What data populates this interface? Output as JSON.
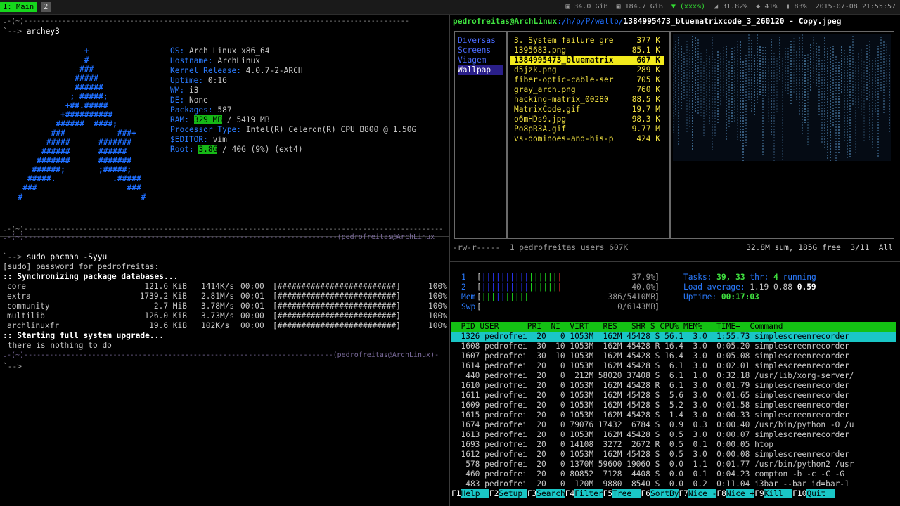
{
  "topbar": {
    "workspaces": [
      {
        "label": "1: Main"
      },
      {
        "label": "2"
      }
    ],
    "status": {
      "disk1": "34.0 GiB",
      "disk2": "184.7 GiB",
      "wifi": "(xxx%)",
      "wifi_signal": "31.82%",
      "temp": "41%",
      "battery": "83%",
      "datetime": "2015-07-08 21:55:57"
    }
  },
  "left_top": {
    "prompt1": ".-(~)-------------------------------------------------------------------------------------------",
    "prompt2": "`--> ",
    "command": "archey3",
    "logo_lines": [
      "                +",
      "                #",
      "               ###",
      "              #####",
      "              ######",
      "             ; #####;",
      "            +##.#####",
      "           +##########",
      "          ######  ####;",
      "         ###           ###+",
      "        #####      #######",
      "       ######      ######",
      "      #######      #######",
      "     ######;       ;#####;",
      "    #####.            .#####",
      "   ###                   ###",
      "  #                         #"
    ],
    "info": [
      {
        "key": "OS:",
        "value": " Arch Linux x86_64"
      },
      {
        "key": "Hostname:",
        "value": " ArchLinux"
      },
      {
        "key": "Kernel Release:",
        "value": " 4.0.7-2-ARCH"
      },
      {
        "key": "Uptime:",
        "value": " 0:16"
      },
      {
        "key": "WM:",
        "value": " i3"
      },
      {
        "key": "DE:",
        "value": " None"
      },
      {
        "key": "Packages:",
        "value": " 587"
      },
      {
        "key": "RAM:",
        "value_hl": "329 MB",
        "value": " / 5419 MB"
      },
      {
        "key": "Processor Type:",
        "value": " Intel(R) Celeron(R) CPU B800 @ 1.50G"
      },
      {
        "key": "$EDITOR:",
        "value": " vim"
      },
      {
        "key": "Root:",
        "value_hl": "3.8G",
        "value": " / 40G (9%) (ext4)"
      }
    ],
    "bottom_prompt": ".-(~)---------------------------------------------------------------------------------------------------"
  },
  "left_bottom": {
    "prompt_top": ".-(~)--------------------------------------------------------------------------(pedrofreitas@ArchLinux",
    "prompt_cmd_arrow": "`--> ",
    "command": "sudo pacman -Syyu",
    "sudo_line": "[sudo] password for pedrofreitas:",
    "sync_line": ":: Synchronizing package databases...",
    "repos": [
      {
        "name": "core",
        "size": "121.6 KiB",
        "speed": "1414K/s",
        "time": "00:00",
        "bar": "[#########################]",
        "pct": "100%"
      },
      {
        "name": "extra",
        "size": "1739.2 KiB",
        "speed": "2.81M/s",
        "time": "00:01",
        "bar": "[#########################]",
        "pct": "100%"
      },
      {
        "name": "community",
        "size": "2.7 MiB",
        "speed": "3.78M/s",
        "time": "00:01",
        "bar": "[#########################]",
        "pct": "100%"
      },
      {
        "name": "multilib",
        "size": "126.0 KiB",
        "speed": "3.73M/s",
        "time": "00:00",
        "bar": "[#########################]",
        "pct": "100%"
      },
      {
        "name": "archlinuxfr",
        "size": "19.6 KiB",
        "speed": "102K/s",
        "time": "00:00",
        "bar": "[#########################]",
        "pct": "100%"
      }
    ],
    "upgrade_line": ":: Starting full system upgrade...",
    "nothing_line": " there is nothing to do",
    "prompt_end": ".-(~)-------------------------------------------------------------------------(pedrofreitas@ArchLinux)-",
    "prompt_last": "`--> "
  },
  "ranger": {
    "path_user": "pedrofreitas@ArchLinux",
    "path_dir": ":/h/p/P/wallp/",
    "path_file": "1384995473_bluematrixcode_3_260120 - Copy.jpeg",
    "dirs": [
      {
        "label": "Diversas"
      },
      {
        "label": "Screens"
      },
      {
        "label": "Viagem"
      },
      {
        "label": "Wallpap"
      }
    ],
    "files": [
      {
        "name": "3. System failure gre",
        "size": "377 K"
      },
      {
        "name": "1395683.png",
        "size": "85.1 K"
      },
      {
        "name": "1384995473_bluematrix",
        "size": "607 K"
      },
      {
        "name": "d5jzk.png",
        "size": "289 K"
      },
      {
        "name": "fiber-optic-cable-ser",
        "size": "705 K"
      },
      {
        "name": "gray_arch.png",
        "size": "760 K"
      },
      {
        "name": "hacking-matrix_00280",
        "size": "88.5 K"
      },
      {
        "name": "MatrixCode.gif",
        "size": "19.7 M"
      },
      {
        "name": "o6mHDs9.jpg",
        "size": "98.3 K"
      },
      {
        "name": "Po8pR3A.gif",
        "size": "9.77 M"
      },
      {
        "name": "vs-dominoes-and-his-p",
        "size": "424 K"
      }
    ],
    "status_left": "-rw-r-----  1 pedrofreitas users 607K",
    "status_right": "32.8M sum, 185G free  3/11  All"
  },
  "htop": {
    "cpus": [
      {
        "n": "1",
        "pct": "37.9%"
      },
      {
        "n": "2",
        "pct": "40.0%"
      }
    ],
    "mem_label": "Mem",
    "mem_val": "386/5410MB",
    "swp_label": "Swp",
    "swp_val": "0/6143MB",
    "tasks_label": "Tasks:",
    "tasks_val": "39,",
    "thr_val": "33",
    "thr_label": " thr;",
    "running_val": "4",
    "running_label": " running",
    "load_label": "Load average:",
    "load1": "1.19",
    "load5": "0.88",
    "load15": "0.59",
    "uptime_label": "Uptime:",
    "uptime_val": "00:17:03",
    "header": "  PID USER      PRI  NI  VIRT   RES   SHR S CPU% MEM%   TIME+  Command",
    "rows": [
      "1326 pedrofrei  20   0 1053M  162M 45428 S 56.1  3.0  1:55.73 simplescreenrecorder",
      "1608 pedrofrei  30  10 1053M  162M 45428 R 16.4  3.0  0:05.20 simplescreenrecorder",
      "1607 pedrofrei  30  10 1053M  162M 45428 S 16.4  3.0  0:05.08 simplescreenrecorder",
      "1614 pedrofrei  20   0 1053M  162M 45428 S  6.1  3.0  0:02.01 simplescreenrecorder",
      " 440 pedrofrei  20   0  212M 58020 37408 S  6.1  1.0  0:32.18 /usr/lib/xorg-server/",
      "1610 pedrofrei  20   0 1053M  162M 45428 R  6.1  3.0  0:01.79 simplescreenrecorder",
      "1611 pedrofrei  20   0 1053M  162M 45428 S  5.6  3.0  0:01.65 simplescreenrecorder",
      "1609 pedrofrei  20   0 1053M  162M 45428 S  5.2  3.0  0:01.58 simplescreenrecorder",
      "1615 pedrofrei  20   0 1053M  162M 45428 S  1.4  3.0  0:00.33 simplescreenrecorder",
      "1674 pedrofrei  20   0 79076 17432  6784 S  0.9  0.3  0:00.40 /usr/bin/python -O /u",
      "1613 pedrofrei  20   0 1053M  162M 45428 S  0.5  3.0  0:00.07 simplescreenrecorder",
      "1693 pedrofrei  20   0 14108  3272  2672 R  0.5  0.1  0:00.05 htop",
      "1612 pedrofrei  20   0 1053M  162M 45428 S  0.5  3.0  0:00.08 simplescreenrecorder",
      " 578 pedrofrei  20   0 1370M 59600 19060 S  0.0  1.1  0:01.77 /usr/bin/python2 /usr",
      " 460 pedrofrei  20   0 80852  7128  4408 S  0.0  0.1  0:04.23 compton -b -c -C -G",
      " 483 pedrofrei  20   0  120M  9880  8540 S  0.0  0.2  0:11.04 i3bar --bar_id=bar-1"
    ],
    "fkeys": [
      {
        "key": "F1",
        "label": "Help  "
      },
      {
        "key": "F2",
        "label": "Setup "
      },
      {
        "key": "F3",
        "label": "Search"
      },
      {
        "key": "F4",
        "label": "Filter"
      },
      {
        "key": "F5",
        "label": "Tree  "
      },
      {
        "key": "F6",
        "label": "SortBy"
      },
      {
        "key": "F7",
        "label": "Nice -"
      },
      {
        "key": "F8",
        "label": "Nice +"
      },
      {
        "key": "F9",
        "label": "Kill  "
      },
      {
        "key": "F10",
        "label": "Quit  "
      }
    ]
  }
}
